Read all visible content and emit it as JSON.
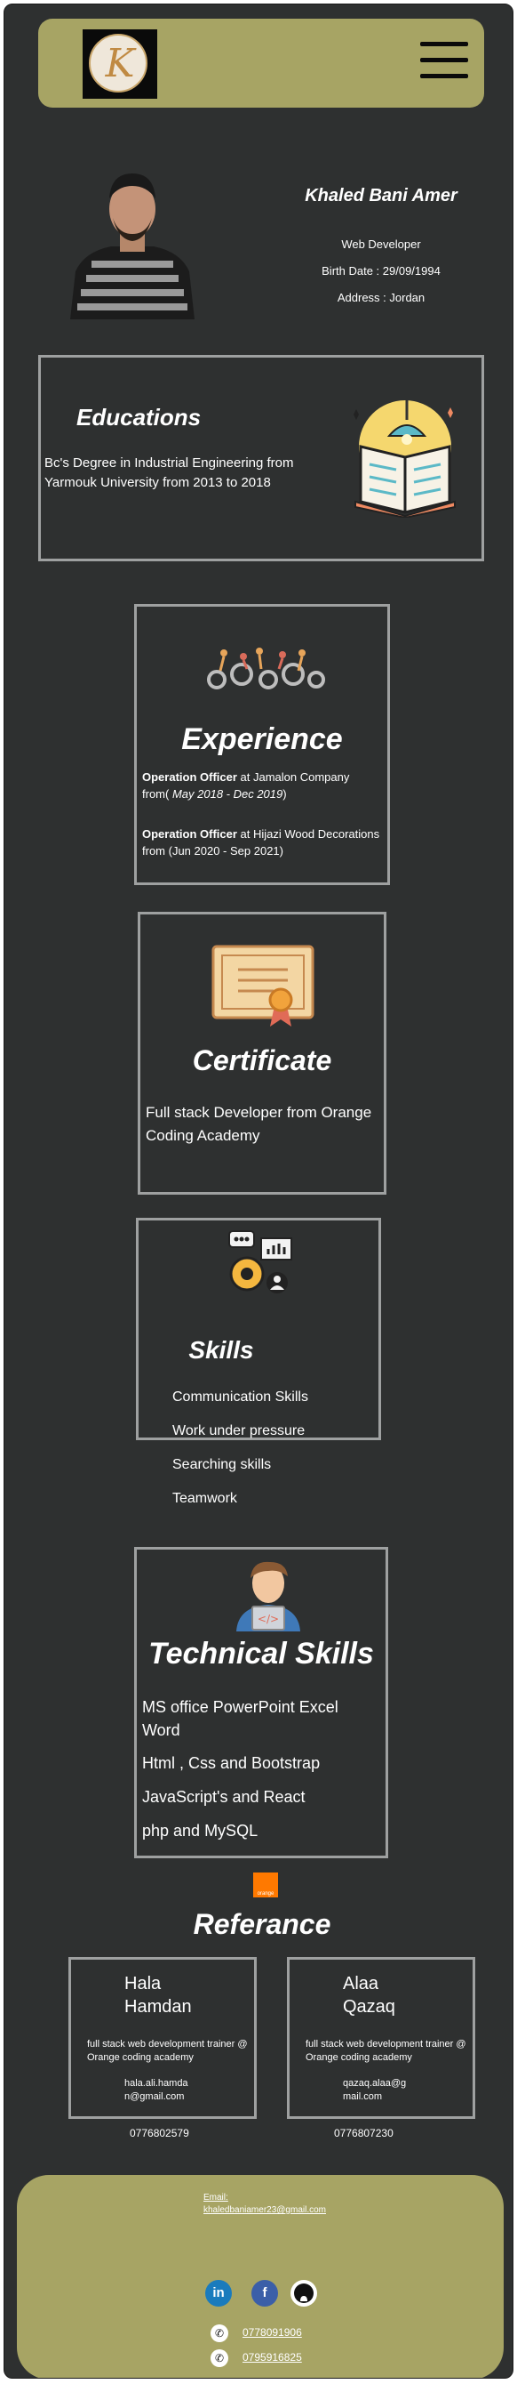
{
  "header": {
    "logo_letter": "K",
    "menu_icon": "hamburger-icon"
  },
  "profile": {
    "name": "Khaled Bani Amer",
    "role": "Web Developer",
    "birth": "Birth Date : 29/09/1994",
    "address": "Address : Jordan"
  },
  "education": {
    "title": "Educations",
    "text": "Bc's Degree in Industrial Engineering from Yarmouk University from 2013 to 2018"
  },
  "experience": {
    "title": "Experience",
    "job1_title": "Operation Officer",
    "job1_company": " at Jamalon Company",
    "job1_from": "from(",
    "job1_dates": " May 2018 - Dec 2019",
    "job1_close": ")",
    "job2_title": "Operation Officer",
    "job2_company": " at Hijazi Wood Decorations",
    "job2_dates": "from (Jun 2020 - Sep 2021)"
  },
  "certificate": {
    "title": "Certificate",
    "text": "Full stack Developer from Orange Coding Academy"
  },
  "skills": {
    "title": "Skills",
    "items": [
      "Communication Skills",
      "Work under pressure",
      "Searching skills",
      "Teamwork"
    ]
  },
  "technical": {
    "title": "Technical  Skills",
    "items": [
      "MS office PowerPoint Excel Word",
      "Html , Css and Bootstrap",
      "JavaScript's and React",
      "php and MySQL"
    ]
  },
  "referance": {
    "title": "Referance",
    "orange_logo_text": "orange",
    "people": [
      {
        "name_line1": "Hala",
        "name_line2": "Hamdan",
        "role": "full stack web development trainer @ Orange coding academy",
        "email_line1": "hala.ali.hamda",
        "email_line2": "n@gmail.com",
        "phone": "0776802579"
      },
      {
        "name_line1": "Alaa",
        "name_line2": "Qazaq",
        "role": "full stack web development trainer @ Orange coding academy",
        "email_line1": "qazaq.alaa@g",
        "email_line2": "mail.com",
        "phone": "0776807230"
      }
    ]
  },
  "footer": {
    "email_label": "Email:",
    "email": "khaledbaniamer23@gmail.com",
    "social": [
      "linkedin-icon",
      "facebook-icon",
      "github-icon"
    ],
    "linkedin_text": "in",
    "facebook_text": "f",
    "phone1": "0778091906",
    "phone2": "0795916825",
    "phone_glyph": "✆"
  }
}
